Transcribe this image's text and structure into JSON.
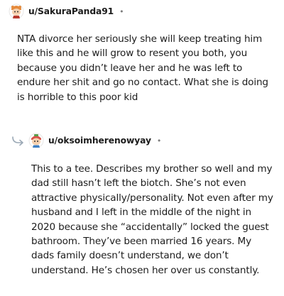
{
  "comments": [
    {
      "username": "u/SakuraPanda91",
      "separator": "•",
      "avatar": "sakura-panda-avatar-icon",
      "body": "NTA divorce her seriously she will keep treating him like this and he will grow to resent you both, you because you didn’t leave her and he was left to endure her shit and go no contact. What she is doing is horrible to this poor kid"
    },
    {
      "username": "u/oksoimherenowyay",
      "separator": "•",
      "avatar": "oksoimherenowyay-avatar-icon",
      "reply_icon": "reply-arrow-icon",
      "body": "This to a tee. Describes my brother so well and my dad still hasn’t left the biotch. She’s not even attractive physically/personality. Not even after my husband and I left in the middle of the night in 2020 because she “accidentally” locked the guest bathroom. They’ve been married 16 years. My dads family doesn’t understand, we don’t understand. He’s chosen her over us constantly."
    }
  ]
}
